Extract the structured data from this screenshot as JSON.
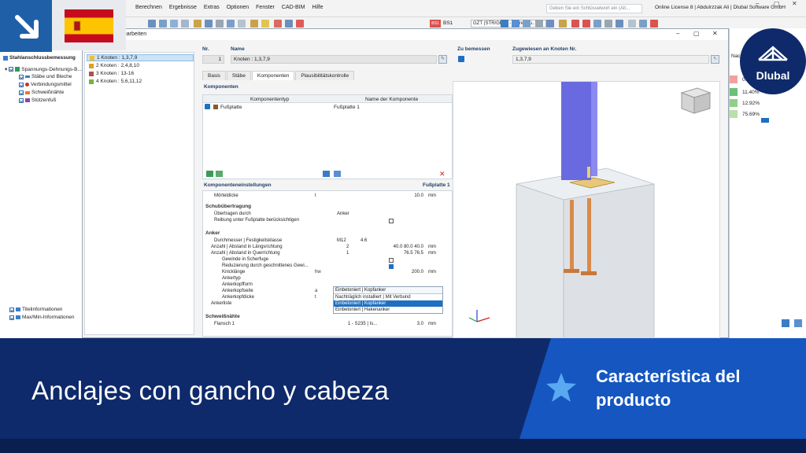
{
  "menu": [
    "Berechnen",
    "Ergebnisse",
    "Extras",
    "Optionen",
    "Fenster",
    "CAD-BIM",
    "Hilfe"
  ],
  "search_placeholder": "Geben Sie ein Schlüsselwort ein (Alt...",
  "license": "Online License 8 | Abdulrzzak Ali | Dlubal Software GmbH",
  "toolbar": {
    "bs_badge": "BS1",
    "combo_value": "GZT (STR/GEO) - Ständig u..."
  },
  "tree": {
    "root": "Stahlanschlussbemessung",
    "group": "Spannungs-Dehnungs-B...",
    "items": [
      "Stäbe und Bleche",
      "Verbindungsmittel",
      "Schweißnähte",
      "Stützenfuß"
    ],
    "bottom": [
      "Titelinformationen",
      "Max/Min-Informationen"
    ]
  },
  "dialog": {
    "title": "bearbeiten",
    "knoten": [
      {
        "label": "1  Knoten : 1,3,7,9",
        "color": "#f0c030"
      },
      {
        "label": "2  Knoten : 2,4,8,10",
        "color": "#e0a020"
      },
      {
        "label": "3  Knoten : 13-16",
        "color": "#b05050"
      },
      {
        "label": "4  Knoten : 5,6,11,12",
        "color": "#7ab03a"
      }
    ],
    "nr_label": "Nr.",
    "nr_value": "1",
    "name_label": "Name",
    "name_value": "Knoten : 1,3,7,9",
    "zu_bemessen_label": "Zu bemessen",
    "zugewiesen_label": "Zugewiesen an Knoten Nr.",
    "zugewiesen_value": "1,3,7,9",
    "tabs": [
      "Basis",
      "Stäbe",
      "Komponenten",
      "Plausibilitätskontrolle"
    ],
    "komponenten_title": "Komponenten",
    "komp_headers": [
      "Komponententyp",
      "Name der Komponente"
    ],
    "komp_row": [
      "Fußplatte",
      "Fußplatte 1"
    ],
    "settings_title": "Komponenteneinstellungen",
    "settings_right": "Fußplatte 1",
    "mortel": {
      "label": "Mörteldicke",
      "sym": "t",
      "num": "10.0",
      "unit": "mm"
    },
    "schub_group": "Schubübertragung",
    "uebertragen": {
      "label": "Übertragen durch",
      "v1": "Anker"
    },
    "reibung": "Reibung unter Fußplatte berücksichtigen",
    "anker_group": "Anker",
    "durchmesser": {
      "label": "Durchmesser | Festigkeitsklasse",
      "v1": "M12",
      "v2": "4.6"
    },
    "abstand_l": {
      "label": "Anzahl | Abstand in Längsrichtung",
      "v1": "2",
      "num": "40.0 80.0 40.0",
      "unit": "mm"
    },
    "abstand_q": {
      "label": "Anzahl | Abstand in Querrichtung",
      "v1": "1",
      "num": "76.5 76.5",
      "unit": "mm"
    },
    "gewinde": "Gewinde in Scherfuge",
    "reduzierung": "Reduzierung durch geschnittenes Gewi...",
    "knicklaenge": {
      "label": "Knicklänge",
      "sym": "hw",
      "num": "200.0",
      "unit": "mm"
    },
    "ankertyp": "Ankertyp",
    "ankerkopfform": "Ankerkopfform",
    "ankerkopfseite": {
      "label": "Ankerkopfseite",
      "sym": "a"
    },
    "ankerkopfdicke": {
      "label": "Ankerkopfdicke",
      "sym": "t"
    },
    "ankerliste": "Ankerliste",
    "schweiss_group": "Schweißnähte",
    "flansch": {
      "label": "Flansch 1",
      "v1": "1 - S235 | Is...",
      "num": "3.0",
      "unit": "mm"
    },
    "dropdown": {
      "current": "Einbetoniert | Kopfanker",
      "options": [
        "Nachträglich installiert | Mit Verbund",
        "Einbetoniert | Kopfanker",
        "Einbetoniert | Hakenanker"
      ]
    }
  },
  "right_panel": {
    "title": "Nachwe...",
    "values": [
      "0.00%",
      "11.40%",
      "12.92%",
      "75.69%"
    ]
  },
  "logo_text": "Dlubal",
  "banner": {
    "title": "Anclajes con gancho y cabeza",
    "subtitle": "Característica del producto"
  },
  "colors": {
    "banner_dark": "#0f2a6b",
    "banner_accent": "#1556c0",
    "column": "#6a6ae0",
    "plate": "#e8c878",
    "anchor": "#d98a4a"
  }
}
